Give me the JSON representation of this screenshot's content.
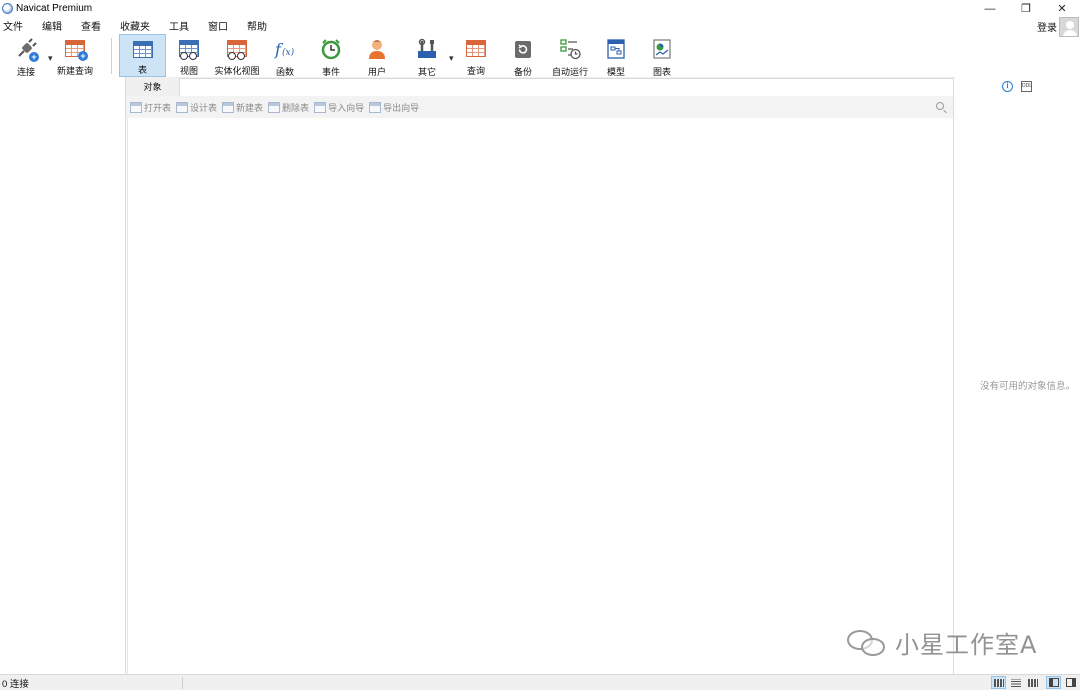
{
  "window": {
    "title": "Navicat Premium",
    "controls": {
      "minimize": "—",
      "restore": "❐",
      "close": "✕"
    }
  },
  "menu": [
    "文件",
    "编辑",
    "查看",
    "收藏夹",
    "工具",
    "窗口",
    "帮助"
  ],
  "account": {
    "login_label": "登录"
  },
  "toolbar": {
    "connect": "连接",
    "new_query": "新建查询",
    "table": "表",
    "view": "视图",
    "materialized_view": "实体化视图",
    "function": "函数",
    "event": "事件",
    "user": "用户",
    "other": "其它",
    "query": "查询",
    "backup": "备份",
    "automation": "自动运行",
    "model": "模型",
    "chart": "图表",
    "active_tool": "表"
  },
  "objects_tab": {
    "label": "对象"
  },
  "object_toolbar": [
    "打开表",
    "设计表",
    "新建表",
    "删除表",
    "导入向导",
    "导出向导"
  ],
  "info_panel": {
    "empty_message": "没有可用的对象信息。"
  },
  "watermark": {
    "text": "小星工作室A"
  },
  "status": {
    "connections": "0 连接"
  },
  "colors": {
    "accent_blue": "#2f7bd6",
    "active_tool_bg": "#cde4f7",
    "panel_bg": "#f0f0f0",
    "muted_text": "#999999"
  }
}
